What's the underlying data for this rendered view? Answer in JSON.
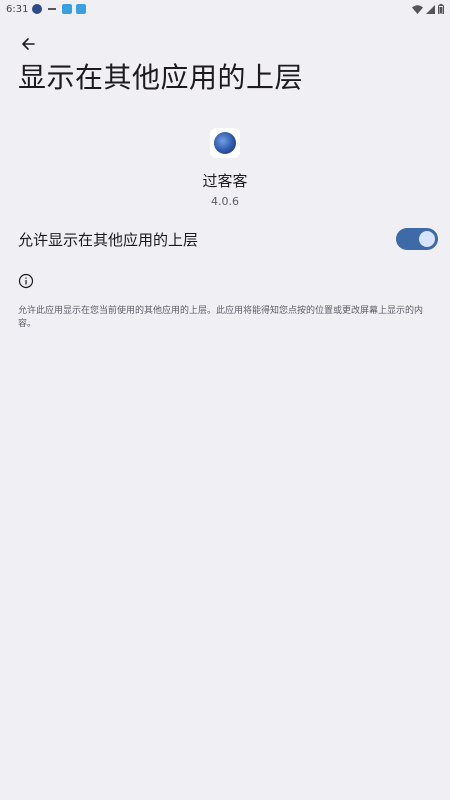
{
  "status_bar": {
    "time": "6:31"
  },
  "header": {
    "title": "显示在其他应用的上层"
  },
  "app": {
    "name": "过客客",
    "version": "4.0.6"
  },
  "setting": {
    "label": "允许显示在其他应用的上层",
    "enabled": true
  },
  "info": {
    "text": "允许此应用显示在您当前使用的其他应用的上层。此应用将能得知您点按的位置或更改屏幕上显示的内容。"
  },
  "colors": {
    "background": "#f0eff4",
    "switch_track": "#3f6aa8",
    "switch_thumb": "#d6e4ff"
  }
}
